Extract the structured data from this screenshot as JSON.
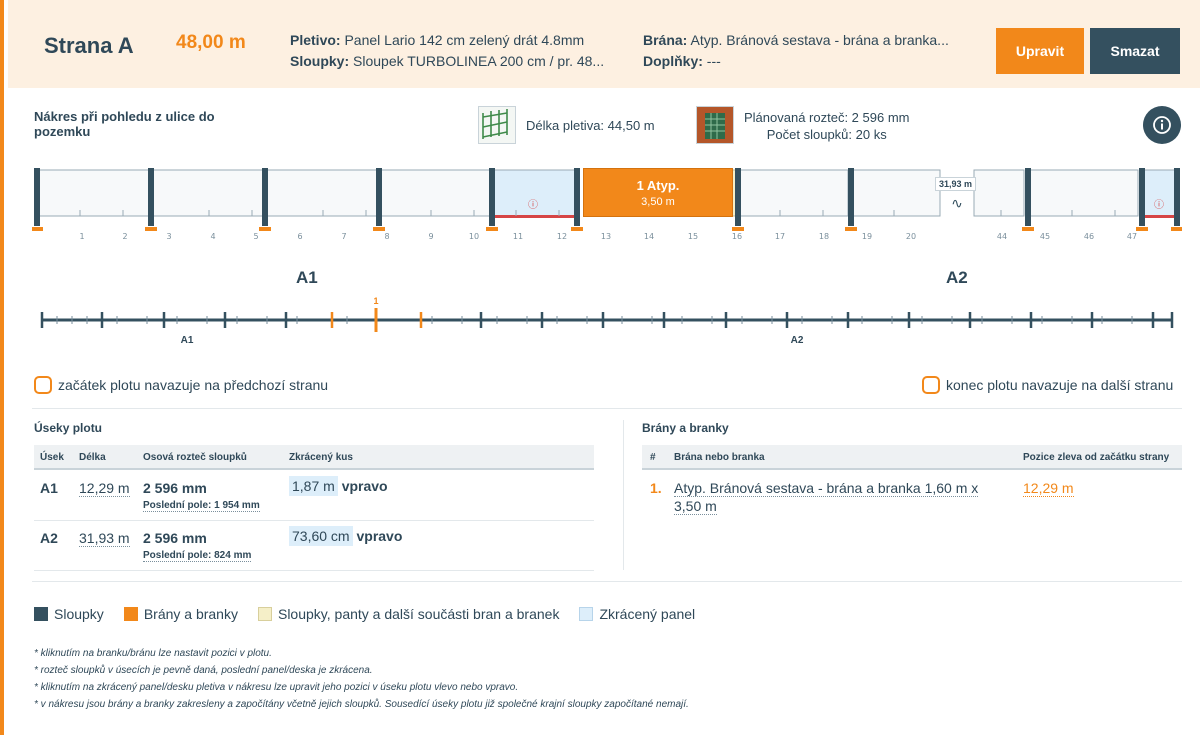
{
  "header": {
    "title": "Strana A",
    "length": "48,00 m",
    "mesh_label": "Pletivo:",
    "mesh_value": "Panel Lario 142 cm zelený drát 4.8mm",
    "posts_label": "Sloupky:",
    "posts_value": "Sloupek TURBOLINEA 200 cm / pr. 48...",
    "gate_label": "Brána:",
    "gate_value": "Atyp. Bránová sestava - brána a branka...",
    "extras_label": "Doplňky:",
    "extras_value": "---",
    "edit_button": "Upravit",
    "delete_button": "Smazat"
  },
  "drawing": {
    "title": "Nákres při pohledu z ulice do pozemku",
    "mesh_length": "Délka pletiva: 44,50 m",
    "post_spacing": "Plánovaná rozteč: 2 596 mm",
    "post_count": "Počet sloupků: 20 ks",
    "gate_name": "1 Atyp.",
    "gate_width": "3,50 m",
    "break_label": "31,93 m",
    "break_symbol": "∿",
    "warning_symbol": "ⓘ",
    "post_numbers": [
      "1",
      "2",
      "3",
      "4",
      "5",
      "6",
      "7",
      "8",
      "9",
      "10",
      "11",
      "12",
      "13",
      "14",
      "15",
      "16",
      "17",
      "18",
      "19",
      "20",
      "44",
      "45",
      "46",
      "47"
    ],
    "section_a1": "A1",
    "section_a2": "A2",
    "line_gate_marker": "1",
    "line_a1": "A1",
    "line_a2": "A2"
  },
  "checkboxes": {
    "start": "začátek plotu navazuje na předchozí stranu",
    "end": "konec plotu navazuje na další stranu"
  },
  "segments": {
    "title": "Úseky plotu",
    "headers": [
      "Úsek",
      "Délka",
      "Osová rozteč sloupků",
      "Zkrácený kus"
    ],
    "rows": [
      {
        "id": "A1",
        "length": "12,29 m",
        "spacing": "2 596 mm",
        "last_field": "Poslední pole: 1 954 mm",
        "cut": "1,87 m",
        "side": "vpravo"
      },
      {
        "id": "A2",
        "length": "31,93 m",
        "spacing": "2 596 mm",
        "last_field": "Poslední pole: 824 mm",
        "cut": "73,60 cm",
        "side": "vpravo"
      }
    ]
  },
  "gates": {
    "title": "Brány a branky",
    "headers": [
      "#",
      "Brána nebo branka",
      "Pozice zleva od začátku strany"
    ],
    "rows": [
      {
        "num": "1.",
        "name_line1": "Atyp. Bránová sestava - brána a branka 1,60 m x",
        "name_line2": "3,50 m",
        "position": "12,29 m"
      }
    ]
  },
  "legend": [
    {
      "label": "Sloupky",
      "color": "#34505f"
    },
    {
      "label": "Brány a branky",
      "color": "#f2881a"
    },
    {
      "label": "Sloupky, panty a další součásti bran a branek",
      "color": "#f5efc8"
    },
    {
      "label": "Zkrácený panel",
      "color": "#ddeefa"
    }
  ],
  "notes": [
    "* kliknutím na branku/bránu lze nastavit pozici v plotu.",
    "* rozteč sloupků v úsecích je pevně daná, poslední panel/deska je zkrácena.",
    "* kliknutím na zkrácený panel/desku pletiva v nákresu lze upravit jeho pozici v úseku plotu vlevo nebo vpravo.",
    "* v nákresu jsou brány a branky zakresleny a započítány včetně jejich sloupků. Sousedící úseky plotu již společné krajní sloupky započítané nemají."
  ],
  "colors": {
    "accent": "#f2881a",
    "post": "#34505f",
    "cut_panel": "#ddeefa",
    "gate_parts": "#f5efc8"
  }
}
